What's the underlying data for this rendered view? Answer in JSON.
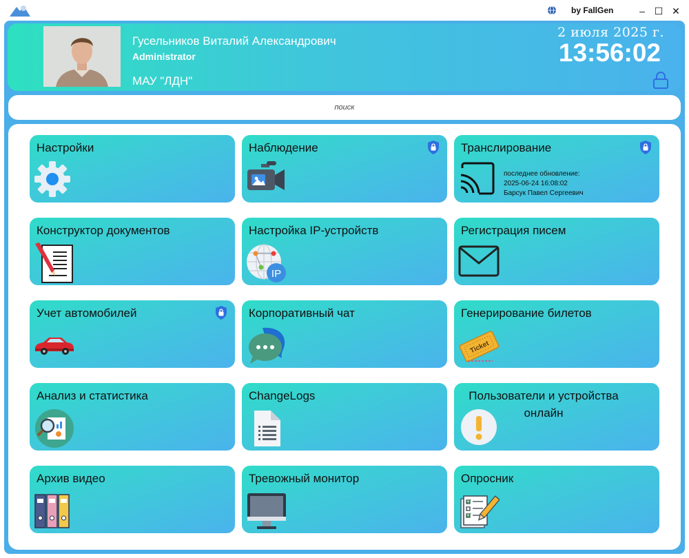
{
  "titlebar": {
    "byline": "by FallGen",
    "minimize": "–",
    "maximize": "☐",
    "close": "✕"
  },
  "header": {
    "user_name": "Гусельников Виталий Александрович",
    "user_role": "Administrator",
    "organization": "МАУ \"ЛДН\"",
    "date": "2 июля 2025 г.",
    "time": "13:56:02"
  },
  "search": {
    "placeholder": "поиск"
  },
  "tiles": [
    {
      "title": "Настройки",
      "icon": "gear-icon"
    },
    {
      "title": "Наблюдение",
      "icon": "video-camera-icon",
      "locked": true
    },
    {
      "title": "Транслирование",
      "icon": "cast-icon",
      "locked": true,
      "info": {
        "line1": "последнее обновление:",
        "line2": "2025-06-24 16:08:02",
        "line3": "Барсук Павел Сергеевич"
      }
    },
    {
      "title": "Конструктор документов",
      "icon": "document-pen-icon"
    },
    {
      "title": "Настройка IP-устройств",
      "icon": "ip-network-icon"
    },
    {
      "title": "Регистрация писем",
      "icon": "envelope-icon"
    },
    {
      "title": "Учет автомобилей",
      "icon": "car-icon",
      "locked": true
    },
    {
      "title": "Корпоративный чат",
      "icon": "chat-bubbles-icon"
    },
    {
      "title": "Генерирование билетов",
      "icon": "ticket-icon",
      "ticket_text": "Ticket"
    },
    {
      "title": "Анализ и статистика",
      "icon": "analytics-icon"
    },
    {
      "title": "ChangeLogs",
      "icon": "file-list-icon"
    },
    {
      "title_line1": "Пользователи и устройства",
      "title_line2": "онлайн",
      "icon": "alert-icon"
    },
    {
      "title": "Архив видео",
      "icon": "binders-icon"
    },
    {
      "title": "Тревожный монитор",
      "icon": "monitor-icon"
    },
    {
      "title": "Опросник",
      "icon": "survey-icon"
    }
  ],
  "colors": {
    "header_gradient_start": "#2ee0c0",
    "header_gradient_end": "#4ab2ec",
    "frame": "#4aaee8",
    "tile_gradient_start": "#2fdcc8",
    "tile_gradient_end": "#4ab3ec",
    "lock_icon": "#2e6fe0"
  }
}
